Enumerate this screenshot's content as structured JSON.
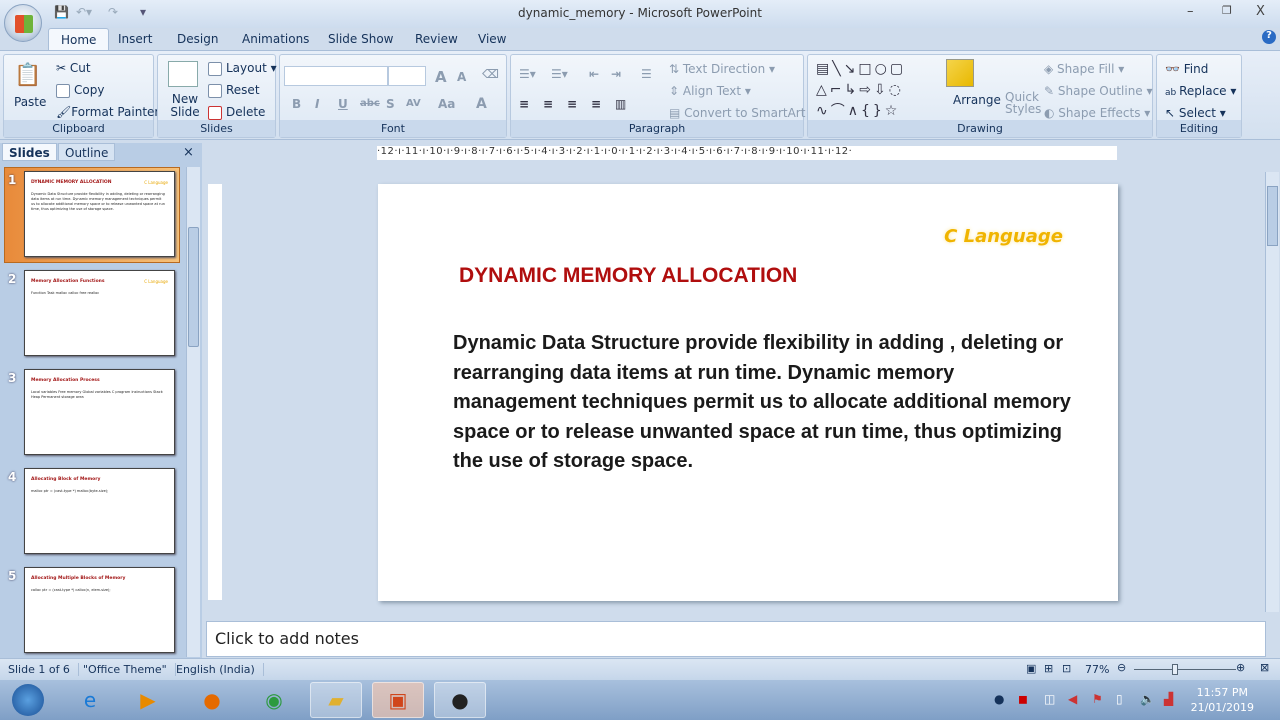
{
  "window": {
    "title": "dynamic_memory - Microsoft PowerPoint",
    "minimize": "–",
    "restore": "❐",
    "close": "X",
    "help": "?"
  },
  "tabs": [
    "Home",
    "Insert",
    "Design",
    "Animations",
    "Slide Show",
    "Review",
    "View"
  ],
  "ribbon": {
    "clipboard": {
      "label": "Clipboard",
      "paste": "Paste",
      "cut": "Cut",
      "copy": "Copy",
      "format_painter": "Format Painter"
    },
    "slides": {
      "label": "Slides",
      "new_slide": "New Slide",
      "layout": "Layout",
      "reset": "Reset",
      "delete": "Delete"
    },
    "font": {
      "label": "Font",
      "bold": "B",
      "italic": "I",
      "underline": "U",
      "strike": "abc",
      "shadow": "S",
      "spacing": "AV",
      "case": "Aa",
      "color": "A",
      "grow": "A",
      "shrink": "A"
    },
    "paragraph": {
      "label": "Paragraph",
      "text_direction": "Text Direction",
      "align_text": "Align Text",
      "convert_smartart": "Convert to SmartArt"
    },
    "drawing": {
      "label": "Drawing",
      "arrange": "Arrange",
      "quick_styles": "Quick Styles",
      "shape_fill": "Shape Fill",
      "shape_outline": "Shape Outline",
      "shape_effects": "Shape Effects"
    },
    "editing": {
      "label": "Editing",
      "find": "Find",
      "replace": "Replace",
      "select": "Select"
    }
  },
  "panel": {
    "tabs": [
      "Slides",
      "Outline"
    ],
    "close": "×",
    "thumbs": [
      {
        "num": "1",
        "title": "DYNAMIC MEMORY ALLOCATION",
        "tag": "C Language",
        "body": "Dynamic Data Structure provide flexibility in adding, deleting or rearranging data items at run time. Dynamic memory management techniques permit us to allocate additional memory space or to release unwanted space at run time, thus optimizing the use of storage space."
      },
      {
        "num": "2",
        "title": "Memory Allocation Functions",
        "tag": "C Language",
        "body": "Function  Task  malloc  calloc  free  realloc"
      },
      {
        "num": "3",
        "title": "Memory Allocation Process",
        "tag": "",
        "body": "Local variables  Free memory  Global variables  C program instructions  Stack  Heap  Permanent storage area"
      },
      {
        "num": "4",
        "title": "Allocating Block of Memory",
        "tag": "",
        "body": "malloc  ptr = (cast-type *) malloc(byte-size);"
      },
      {
        "num": "5",
        "title": "Allocating Multiple Blocks of Memory",
        "tag": "",
        "body": "calloc  ptr = (cast-type *) calloc(n, elem-size);"
      }
    ]
  },
  "ruler": {
    "h": "·12·ı·11·ı·10·ı·9·ı·8·ı·7·ı·6·ı·5·ı·4·ı·3·ı·2·ı·1·ı·0·ı·1·ı·2·ı·3·ı·4·ı·5·ı·6·ı·7·ı·8·ı·9·ı·10·ı·11·ı·12·"
  },
  "slide": {
    "tag": "C Language",
    "title": "DYNAMIC MEMORY ALLOCATION",
    "body": "Dynamic Data Structure provide flexibility in adding , deleting or rearranging data items at run time. Dynamic memory management techniques permit us to allocate additional memory space or to release unwanted space at run time, thus optimizing the use of storage space."
  },
  "notes": {
    "placeholder": "Click to add notes"
  },
  "status": {
    "slide": "Slide 1 of 6",
    "theme": "\"Office Theme\"",
    "language": "English (India)",
    "zoom": "77%",
    "zoom_percent": 77
  },
  "taskbar": {
    "time": "11:57 PM",
    "date": "21/01/2019"
  }
}
